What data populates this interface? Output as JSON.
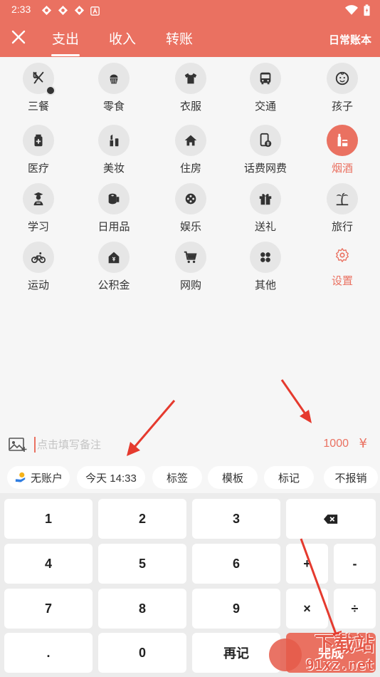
{
  "status": {
    "time": "2:33"
  },
  "tabs": [
    {
      "label": "支出"
    },
    {
      "label": "收入"
    },
    {
      "label": "转账"
    }
  ],
  "book_label": "日常账本",
  "categories": [
    {
      "label": "三餐",
      "icon": "utensils-icon"
    },
    {
      "label": "零食",
      "icon": "cupcake-icon"
    },
    {
      "label": "衣服",
      "icon": "shirt-icon"
    },
    {
      "label": "交通",
      "icon": "bus-icon"
    },
    {
      "label": "孩子",
      "icon": "baby-icon"
    },
    {
      "label": "医疗",
      "icon": "medicine-icon"
    },
    {
      "label": "美妆",
      "icon": "lipstick-icon"
    },
    {
      "label": "住房",
      "icon": "house-icon"
    },
    {
      "label": "话费网费",
      "icon": "phone-icon"
    },
    {
      "label": "烟酒",
      "icon": "bottle-icon"
    },
    {
      "label": "学习",
      "icon": "student-icon"
    },
    {
      "label": "日用品",
      "icon": "toilet-paper-icon"
    },
    {
      "label": "娱乐",
      "icon": "film-reel-icon"
    },
    {
      "label": "送礼",
      "icon": "gift-icon"
    },
    {
      "label": "旅行",
      "icon": "palm-tree-icon"
    },
    {
      "label": "运动",
      "icon": "bicycle-icon"
    },
    {
      "label": "公积金",
      "icon": "fund-house-icon"
    },
    {
      "label": "网购",
      "icon": "cart-icon"
    },
    {
      "label": "其他",
      "icon": "grid-icon"
    },
    {
      "label": "设置",
      "icon": "gear-icon"
    }
  ],
  "selected_category": "烟酒",
  "note": {
    "placeholder": "点击填写备注",
    "value": ""
  },
  "amount": "1000",
  "currency": "¥",
  "chips": [
    {
      "label": "无账户"
    },
    {
      "label": "今天 14:33"
    },
    {
      "label": "标签"
    },
    {
      "label": "模板"
    },
    {
      "label": "标记"
    },
    {
      "label": "不报销"
    }
  ],
  "keys": {
    "k1": "1",
    "k2": "2",
    "k3": "3",
    "k4": "4",
    "k5": "5",
    "k6": "6",
    "k7": "7",
    "k8": "8",
    "k9": "9",
    "dot": ".",
    "k0": "0",
    "again": "再记",
    "plus": "+",
    "minus": "-",
    "times": "×",
    "divide": "÷",
    "done": "完成"
  },
  "watermark": {
    "title": "下载站",
    "url": "91xz.net"
  },
  "colors": {
    "accent": "#ea7161",
    "background": "#f6f6f6",
    "chip": "#ffffff",
    "annotation": "#e53a2e"
  }
}
